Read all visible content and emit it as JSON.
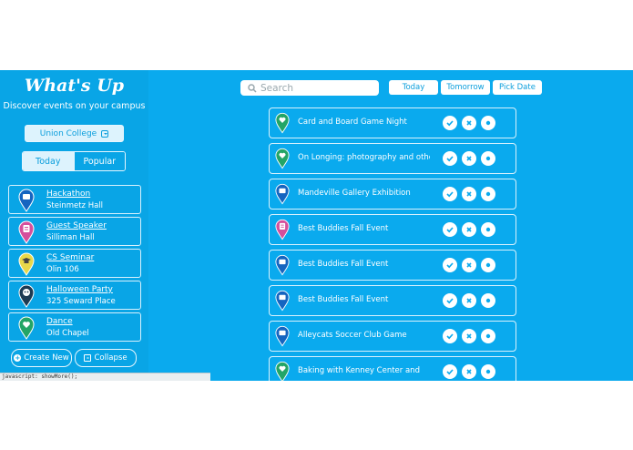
{
  "app": {
    "title": "What's Up",
    "subtitle": "Discover events on your campus"
  },
  "college_select": {
    "value": "Union College"
  },
  "view_toggle": {
    "today": "Today",
    "popular": "Popular"
  },
  "my_events": [
    {
      "name": "Hackathon",
      "place": "Steinmetz Hall",
      "color": "#1565c0",
      "icon": "calendar-icon"
    },
    {
      "name": "Guest Speaker",
      "place": "Silliman Hall",
      "color": "#d54f9c",
      "icon": "id-card-icon"
    },
    {
      "name": "CS Seminar",
      "place": "Olin 106",
      "color": "#e8d84a",
      "icon": "graduation-cap-icon"
    },
    {
      "name": "Halloween Party",
      "place": "325 Seward Place",
      "color": "#1d3a52",
      "icon": "mask-icon"
    },
    {
      "name": "Dance",
      "place": "Old Chapel",
      "color": "#23a566",
      "icon": "heart-icon"
    }
  ],
  "sidebar_buttons": {
    "create": "Create New",
    "collapse": "Collapse"
  },
  "status_bar": {
    "text": "javascript: showMore();"
  },
  "search": {
    "placeholder": "Search"
  },
  "date_filters": {
    "today": "Today",
    "tomorrow": "Tomorrow",
    "pick": "Pick Date"
  },
  "events": [
    {
      "title": "Card and Board Game Night",
      "color": "#23a566"
    },
    {
      "title": "On Longing: photography and other",
      "color": "#23a566"
    },
    {
      "title": "Mandeville Gallery Exhibition",
      "color": "#1565c0"
    },
    {
      "title": "Best Buddies Fall Event",
      "color": "#d54f9c"
    },
    {
      "title": "Best Buddies Fall Event",
      "color": "#1565c0"
    },
    {
      "title": "Best Buddies Fall Event",
      "color": "#1565c0"
    },
    {
      "title": "Alleycats Soccer Club Game",
      "color": "#1565c0"
    },
    {
      "title": "Baking with Kenney Center and",
      "color": "#23a566"
    }
  ],
  "colors": {
    "accent": "#0aaaee",
    "sidebar": "#09a5e6",
    "text_light": "#ffffff",
    "button_text": "#0a9edc"
  }
}
